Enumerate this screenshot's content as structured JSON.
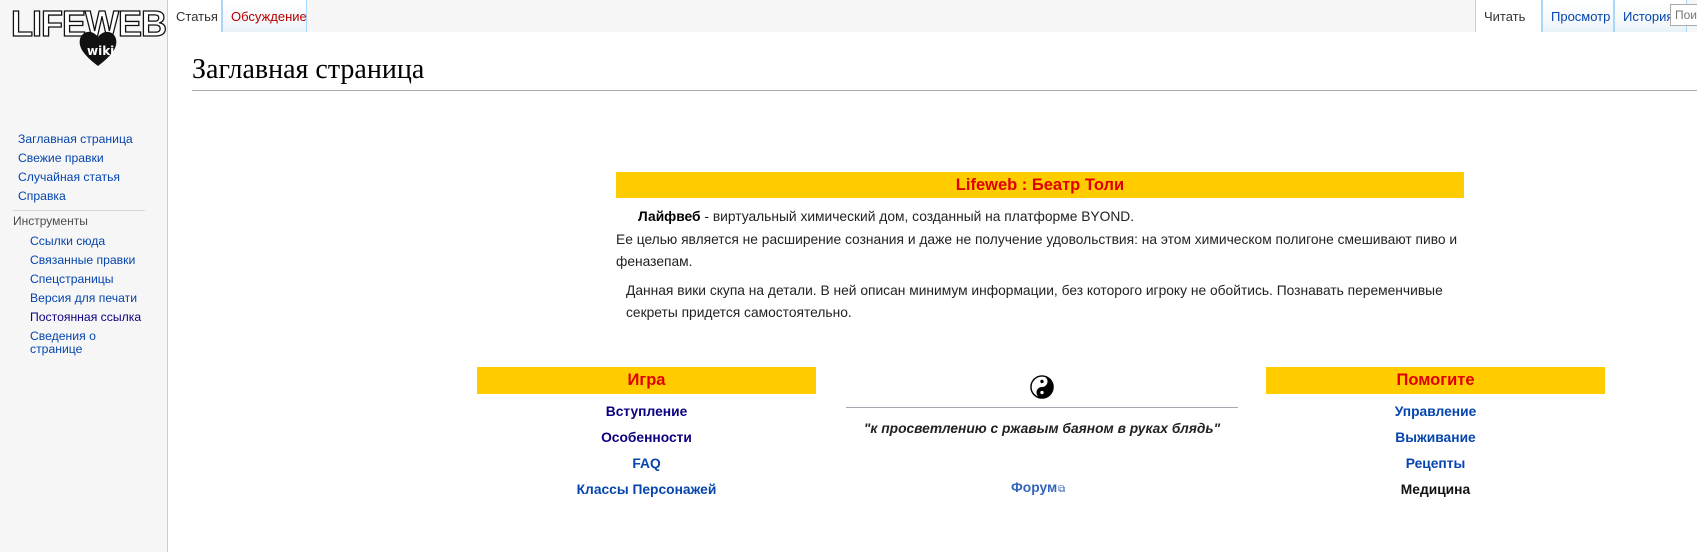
{
  "logo": {
    "text": "LIFEWEB",
    "badge": "wiki",
    "icon": "heart-icon"
  },
  "navigation": {
    "main": [
      "Заглавная страница",
      "Свежие правки",
      "Случайная статья",
      "Справка"
    ],
    "tools_heading": "Инструменты",
    "tools": [
      "Ссылки сюда",
      "Связанные правки",
      "Спецстраницы",
      "Версия для печати",
      "Постоянная ссылка",
      "Сведения о странице"
    ]
  },
  "tabs": {
    "left": [
      "Статья",
      "Обсуждение"
    ],
    "right": [
      "Читать",
      "Просмотр",
      "История"
    ]
  },
  "search": {
    "placeholder": "Поиск"
  },
  "page": {
    "title": "Заглавная страница"
  },
  "intro": {
    "banner": "Lifeweb : Беатр Толи",
    "bold_term": "Лайфвеб",
    "line1_rest": " - виртуальный химический дом, созданный на платформе BYOND.",
    "line2": "Ее целью является не расширение сознания и даже не получение удовольствия: на этом химическом полигоне смешивают пиво и феназепам.",
    "line3": "Данная вики скупа на детали. В ней описан минимум информации, без которого игроку не обойтись. Познавать переменчивые секреты придется самостоятельно."
  },
  "columns": {
    "game": {
      "title": "Игра",
      "links": [
        "Вступление",
        "Особенности",
        "FAQ",
        "Классы Персонажей"
      ]
    },
    "center": {
      "icon": "yin-yang-icon",
      "quote": "\"к просветлению с ржавым баяном в руках блядь\"",
      "forum": "Форум"
    },
    "help": {
      "title": "Помогите",
      "links": [
        "Управление",
        "Выживание",
        "Рецепты",
        "Медицина"
      ]
    }
  },
  "colors": {
    "banner_bg": "#ffcc00",
    "banner_text": "#e00000",
    "link": "#0645ad",
    "visited": "#0b0080",
    "border": "#a7d7f9"
  }
}
